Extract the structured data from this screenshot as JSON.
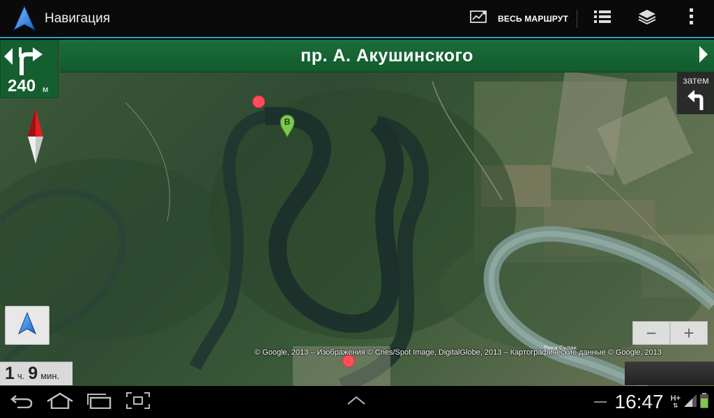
{
  "app": {
    "title": "Навигация",
    "icon": "navigation-arrow-icon"
  },
  "actionbar": {
    "route_label": "ВЕСЬ МАРШРУТ",
    "route_icon": "route-overview-icon",
    "list_icon": "directions-list-icon",
    "layers_icon": "layers-icon",
    "menu_icon": "overflow-menu-icon"
  },
  "turn": {
    "distance": "240",
    "unit": "м",
    "icon": "turn-right-fork-icon"
  },
  "street": {
    "name": "пр.  А. Акушинского"
  },
  "then": {
    "label": "затем",
    "icon": "turn-left-icon"
  },
  "map": {
    "destination_label": "B",
    "attribution": "© Google, 2013 – Изображения © Cnes/Spot Image, DigitalGlobe, 2013 – Картографические данные © Google, 2013",
    "river_label": "Река Сулак"
  },
  "zoom": {
    "out": "−",
    "in": "+"
  },
  "eta": {
    "hours": "1",
    "hours_unit": "ч.",
    "minutes": "9",
    "minutes_unit": "мин."
  },
  "system": {
    "clock": "16:47",
    "network": "H+"
  },
  "colors": {
    "banner": "#155e30",
    "accent": "#2f9fd8",
    "dot": "#ff4d5a",
    "pin": "#7ec850"
  }
}
